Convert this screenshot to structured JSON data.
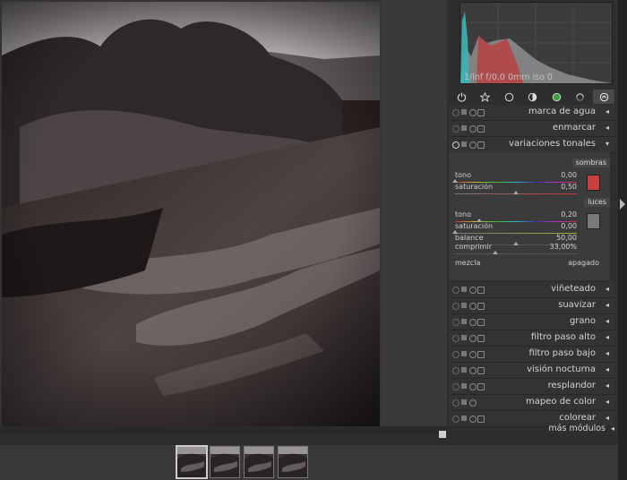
{
  "histogram": {
    "info": "1/inf f/0,0 0mm iso 0",
    "colors": {
      "red": "#b74242",
      "cyan": "#3bb5b5",
      "gray": "#9a9a9a"
    }
  },
  "module_groups": [
    {
      "name": "power-icon",
      "active": false
    },
    {
      "name": "star-icon",
      "active": false
    },
    {
      "name": "circle-icon",
      "active": false
    },
    {
      "name": "half-circle-icon",
      "active": false
    },
    {
      "name": "color-circle-icon",
      "active": false
    },
    {
      "name": "correct-icon",
      "active": false
    },
    {
      "name": "effects-icon",
      "active": true
    }
  ],
  "modules_top": [
    {
      "label": "marca de agua",
      "arrow": "◂"
    },
    {
      "label": "enmarcar",
      "arrow": "◂"
    },
    {
      "label": "variaciones tonales",
      "arrow": "▾"
    }
  ],
  "split_toning": {
    "shadows_title": "sombras",
    "highlights_title": "luces",
    "shadow_color": "#c94040",
    "highlight_color": "#7a7a7a",
    "sliders": [
      {
        "label": "tono",
        "value": "0,00",
        "pos": 0.0
      },
      {
        "label": "saturación",
        "value": "0,50",
        "pos": 0.5
      },
      {
        "label": "tono",
        "value": "0,20",
        "pos": 0.2
      },
      {
        "label": "saturación",
        "value": "0,00",
        "pos": 0.0
      },
      {
        "label": "balance",
        "value": "50,00",
        "pos": 0.5
      },
      {
        "label": "comprimir",
        "value": "33,00%",
        "pos": 0.33
      }
    ],
    "blend_label": "mezcla",
    "blend_value": "apagado"
  },
  "modules_bottom": [
    {
      "label": "viñeteado",
      "arrow": "◂"
    },
    {
      "label": "suavizar",
      "arrow": "◂"
    },
    {
      "label": "grano",
      "arrow": "◂"
    },
    {
      "label": "filtro paso alto",
      "arrow": "◂"
    },
    {
      "label": "filtro paso bajo",
      "arrow": "◂"
    },
    {
      "label": "visión nocturna",
      "arrow": "◂"
    },
    {
      "label": "resplandor",
      "arrow": "◂"
    },
    {
      "label": "mapeo de color",
      "arrow": "◂"
    },
    {
      "label": "colorear",
      "arrow": "◂"
    }
  ],
  "more_modules": {
    "label": "más módulos",
    "arrow": "◂"
  },
  "filmstrip": {
    "thumbnails": 4,
    "active_index": 0
  }
}
